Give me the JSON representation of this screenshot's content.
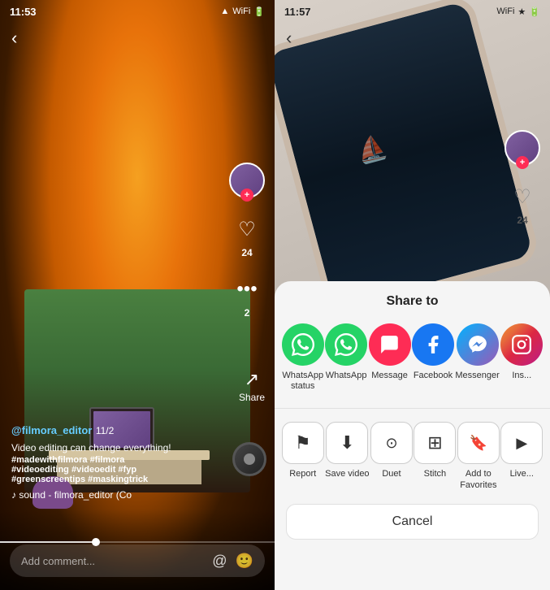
{
  "left": {
    "status": {
      "time": "11:53",
      "icons": [
        "▲",
        "WiFi",
        "🔋"
      ]
    },
    "back": "‹",
    "username": "@filmora_editor",
    "date": "11/2",
    "caption": "Video editing can change everything!",
    "hashtags": "#madewithfilmora #filmora\n#videoediting #videoedit #fyp\n#greenscreentips #maskingtrick",
    "sound": "♪ sound - filmora_editor (Co",
    "like_count": "24",
    "comment_count": "2",
    "share_label": "Share",
    "comment_placeholder": "Add comment...",
    "progress_percent": 35
  },
  "right": {
    "status": {
      "time": "11:57",
      "icons": [
        "WiFi",
        "⭐",
        "🔋"
      ]
    },
    "back": "‹",
    "like_count": "24",
    "share_sheet": {
      "title": "Share to",
      "apps": [
        {
          "name": "WhatsApp status",
          "color": "whatsapp-green",
          "emoji": "💬"
        },
        {
          "name": "WhatsApp",
          "color": "whatsapp-light",
          "emoji": "📱"
        },
        {
          "name": "Message",
          "color": "message-red",
          "emoji": "✉"
        },
        {
          "name": "Facebook",
          "color": "facebook-blue",
          "emoji": "f"
        },
        {
          "name": "Messenger",
          "color": "messenger-purple",
          "emoji": "m"
        },
        {
          "name": "Ins...",
          "color": "instagram-grad",
          "emoji": "📷"
        }
      ],
      "actions": [
        {
          "name": "Report",
          "icon": "⚑"
        },
        {
          "name": "Save video",
          "icon": "⬇"
        },
        {
          "name": "Duet",
          "icon": "⊙"
        },
        {
          "name": "Stitch",
          "icon": "⊞"
        },
        {
          "name": "Add to Favorites",
          "icon": "🔖"
        },
        {
          "name": "Live...",
          "icon": ">"
        }
      ],
      "cancel": "Cancel"
    }
  }
}
